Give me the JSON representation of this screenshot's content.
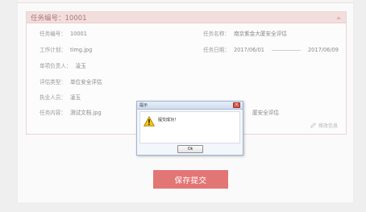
{
  "task": {
    "header_title": "任务编号：10001",
    "fields": {
      "task_no_label": "任务编号：",
      "task_no": "10001",
      "task_name_label": "任务名称：",
      "task_name": "南京紫金大厦安全评估",
      "work_plan_label": "工作计划：",
      "work_plan": "timg.jpg",
      "task_date_label": "任务日期：",
      "date_start": "2017/06/01",
      "date_end": "2017/06/09",
      "owner_label": "单项负责人：",
      "owner": "凌玉",
      "eval_type_label": "评估类型：",
      "eval_type": "单位安全评估",
      "executor_label": "执业人员：",
      "executor": "凌玉",
      "content_label": "任务内容：",
      "content": "测试文档.jpg",
      "partial_name": "厦安全评估"
    },
    "edit_label": "修改信息"
  },
  "save_button_label": "保存提交",
  "dialog": {
    "title": "提示",
    "message": "提交成功！",
    "ok_label": "Ok",
    "close_glyph": "×"
  },
  "colors": {
    "accent": "#e27675",
    "header_bg": "#f3dede"
  },
  "icons": [
    "caret-up-icon",
    "pencil-icon",
    "close-icon",
    "warning-icon"
  ]
}
